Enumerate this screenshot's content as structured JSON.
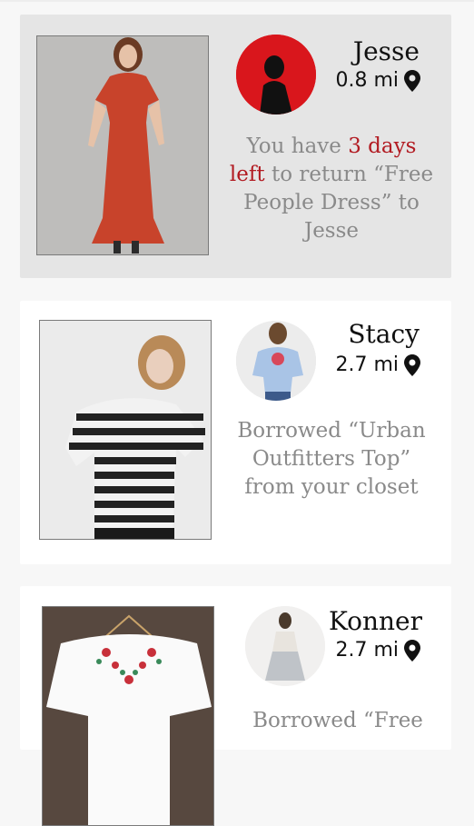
{
  "colors": {
    "accent": "#b21b22",
    "highlight_bg": "#e5e5e5",
    "text_muted": "#8a8a8a"
  },
  "cards": [
    {
      "photo_icon": "red-dress-photo",
      "avatar_icon": "jesse-avatar",
      "name": "Jesse",
      "distance": "0.8 mi",
      "message": {
        "prefix": "You have ",
        "highlight": "3 days left",
        "suffix": " to return “Free People Dress” to Jesse"
      }
    },
    {
      "photo_icon": "striped-top-photo",
      "avatar_icon": "stacy-avatar",
      "name": "Stacy",
      "distance": "2.7 mi",
      "message": {
        "text": "Borrowed “Urban Outfitters Top” from your closet"
      }
    },
    {
      "photo_icon": "embroidered-blouse-photo",
      "avatar_icon": "konner-avatar",
      "name": "Konner",
      "distance": "2.7 mi",
      "message": {
        "text": "Borrowed “Free"
      }
    }
  ]
}
